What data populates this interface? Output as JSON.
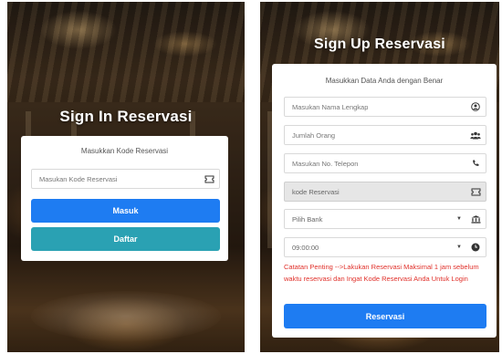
{
  "signin": {
    "title": "Sign In Reservasi",
    "subtitle": "Masukkan Kode Reservasi",
    "code_placeholder": "Masukan Kode Reservasi",
    "code_icon": "ticket-icon",
    "masuk_label": "Masuk",
    "daftar_label": "Daftar",
    "colors": {
      "masuk": "#1e7cf2",
      "daftar": "#2aa1b3"
    }
  },
  "signup": {
    "title": "Sign Up Reservasi",
    "subtitle": "Masukkan Data Anda dengan Benar",
    "nama_placeholder": "Masukan Nama Lengkap",
    "nama_icon": "user-icon",
    "jumlah_placeholder": "Jumlah Orang",
    "jumlah_icon": "users-icon",
    "telepon_placeholder": "Masukan No. Telepon",
    "telepon_icon": "phone-icon",
    "kode_value": "kode Reservasi",
    "kode_icon": "ticket-icon",
    "bank_selected": "Pilih Bank",
    "bank_icon": "bank-icon",
    "jam_value": "09:00:00",
    "jam_icon": "clock-icon",
    "note": "Catatan Penting -->Lakukan Reservasi Maksimal 1 jam sebelum waktu reservasi dan Ingat Kode Reservasi Anda Untuk Login",
    "reservasi_label": "Reservasi",
    "colors": {
      "button": "#1e7cf2",
      "note": "#e0302a"
    }
  }
}
